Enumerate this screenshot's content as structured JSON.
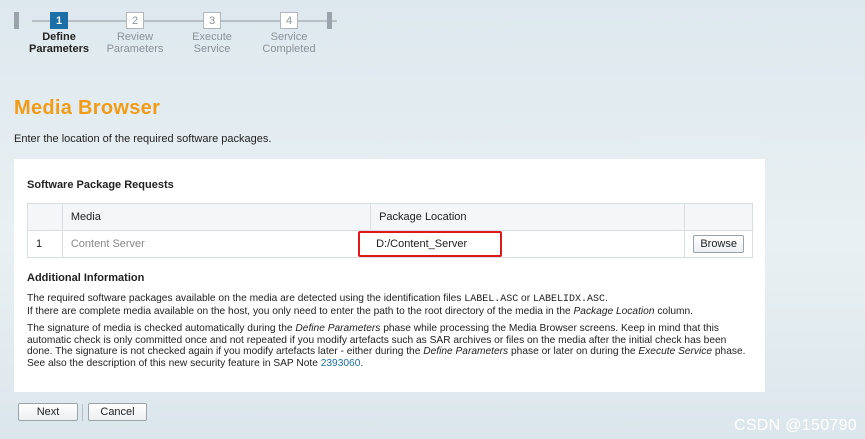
{
  "steps": [
    {
      "num": "1",
      "label_line1": "Define",
      "label_line2": "Parameters",
      "active": true
    },
    {
      "num": "2",
      "label_line1": "Review",
      "label_line2": "Parameters",
      "active": false
    },
    {
      "num": "3",
      "label_line1": "Execute",
      "label_line2": "Service",
      "active": false
    },
    {
      "num": "4",
      "label_line1": "Service",
      "label_line2": "Completed",
      "active": false
    }
  ],
  "page": {
    "title": "Media Browser",
    "intro": "Enter the location of the required software packages."
  },
  "requests": {
    "section_title": "Software Package Requests",
    "columns": [
      "",
      "Media",
      "Package Location",
      ""
    ],
    "rows": [
      {
        "index": "1",
        "media": "Content Server",
        "location": "D:/Content_Server",
        "action": "Browse"
      }
    ]
  },
  "additional": {
    "title": "Additional Information",
    "p1_a": "The required software packages available on the media are detected using the identification files ",
    "p1_file1": "LABEL.ASC",
    "p1_b": " or ",
    "p1_file2": "LABELIDX.ASC",
    "p1_c": ".",
    "p1_line2_a": "If there are complete media available on the host, you only need to enter the path to the root directory of the media in the ",
    "p1_line2_em": "Package Location",
    "p1_line2_b": " column.",
    "p2_a": "The signature of media is checked automatically during the ",
    "p2_em1": "Define Parameters",
    "p2_b": " phase while processing the Media Browser screens. Keep in mind that this automatic check is only committed once and not repeated if you modify artefacts such as SAR archives or files on the media after the initial check has been done. The signature is not checked again if you modify artefacts later - either during the ",
    "p2_em2": "Define Parameters",
    "p2_c": " phase or later on during the ",
    "p2_em3": "Execute Service",
    "p2_d": " phase. See also the description of this new security feature in SAP Note ",
    "p2_link": "2393060",
    "p2_e": "."
  },
  "footer": {
    "next_label": "Next",
    "cancel_label": "Cancel"
  },
  "watermark": "CSDN @150790",
  "colors": {
    "title": "#f29b16",
    "accent": "#1c6fa6",
    "highlight_border": "#e01818"
  }
}
